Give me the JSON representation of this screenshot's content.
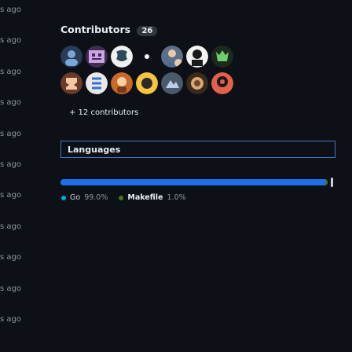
{
  "timestamps": [
    "s ago",
    "s ago",
    "s ago",
    "s ago",
    "s ago",
    "s ago",
    "s ago",
    "s ago",
    "s ago",
    "s ago",
    "s ago"
  ],
  "contributors": {
    "heading": "Contributors",
    "count": "26",
    "more_link": "+ 12 contributors",
    "avatars_row1": [
      "avatar-1",
      "avatar-2",
      "avatar-3",
      "avatar-4",
      "avatar-5",
      "avatar-6",
      "avatar-7"
    ],
    "avatars_row2": [
      "avatar-8",
      "avatar-9",
      "avatar-10",
      "avatar-11",
      "avatar-12",
      "avatar-13",
      "avatar-14"
    ]
  },
  "languages": {
    "heading": "Languages",
    "items": [
      {
        "name": "Go",
        "percent": "99.0%",
        "color": "#00add8",
        "share": 99.0
      },
      {
        "name": "Makefile",
        "percent": "1.0%",
        "color": "#427819",
        "share": 1.0
      }
    ]
  },
  "colors": {
    "background": "#0d1117",
    "text": "#e6edf3",
    "muted": "#8b949e",
    "accent": "#4078c0"
  }
}
